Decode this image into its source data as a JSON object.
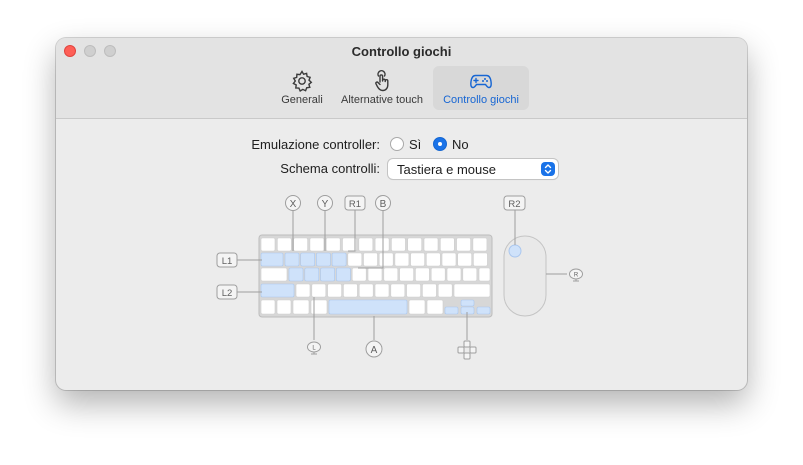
{
  "window": {
    "title": "Controllo giochi"
  },
  "tabs": [
    {
      "label": "Generali",
      "icon": "gear-icon",
      "active": false
    },
    {
      "label": "Alternative touch",
      "icon": "touch-hand-icon",
      "active": false
    },
    {
      "label": "Controllo giochi",
      "icon": "gamecontroller-icon",
      "active": true
    }
  ],
  "emulation": {
    "label": "Emulazione controller:",
    "options": [
      {
        "label": "Sì",
        "selected": false
      },
      {
        "label": "No",
        "selected": true
      }
    ]
  },
  "scheme": {
    "label": "Schema controlli:",
    "value": "Tastiera e mouse"
  },
  "mapping": {
    "x": "X",
    "y": "Y",
    "r1": "R1",
    "b": "B",
    "r2": "R2",
    "l1": "L1",
    "l2": "L2",
    "a": "A",
    "left_stick": "L",
    "right_stick": "R"
  },
  "colors": {
    "accent": "#1a73e8",
    "close": "#fe5f57",
    "highlight_key": "#cfe2fa"
  }
}
